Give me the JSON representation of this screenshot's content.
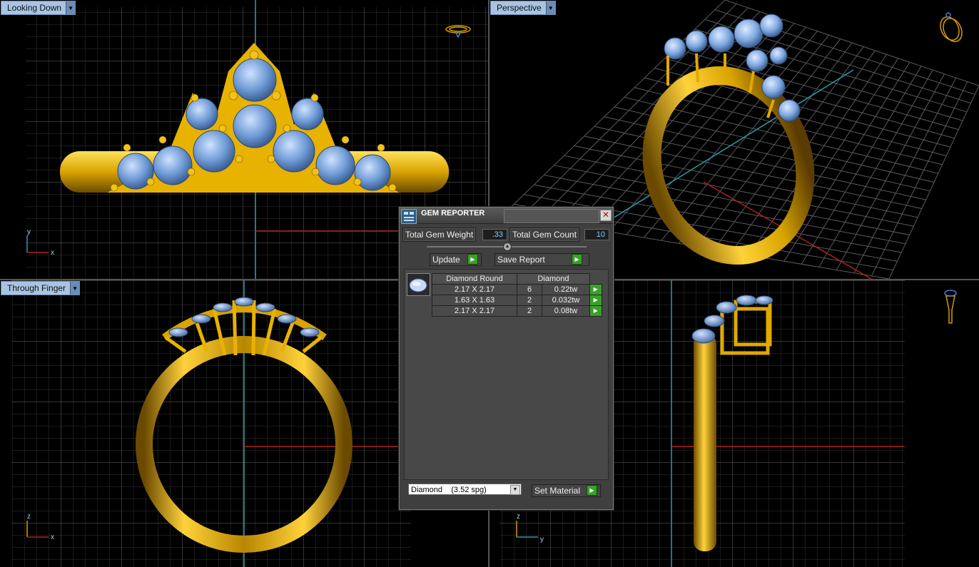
{
  "viewports": {
    "top_left": {
      "label": "Looking Down",
      "axis_a": "y",
      "axis_b": "x"
    },
    "top_right": {
      "label": "Perspective"
    },
    "bottom_left": {
      "label": "Through Finger",
      "axis_a": "z",
      "axis_b": "x"
    },
    "bottom_right": {
      "axis_a": "z",
      "axis_b": "y"
    }
  },
  "gem_reporter": {
    "title": "GEM REPORTER",
    "total_gem_weight_label": "Total Gem Weight",
    "total_gem_weight_value": ".33",
    "total_gem_count_label": "Total Gem Count",
    "total_gem_count_value": "10",
    "update_label": "Update",
    "save_report_label": "Save Report",
    "table": {
      "headers": [
        "Diamond Round",
        "Diamond"
      ],
      "rows": [
        {
          "size": "2.17 X 2.17",
          "count": "6",
          "weight": "0.22tw"
        },
        {
          "size": "1.63 X 1.63",
          "count": "2",
          "weight": "0.032tw"
        },
        {
          "size": "2.17 X 2.17",
          "count": "2",
          "weight": "0.08tw"
        }
      ]
    },
    "material_select": "Diamond    (3.52 spg)",
    "set_material_label": "Set Material"
  },
  "colors": {
    "gold": "#d9a400",
    "gem": "#7fa9e0",
    "grid": "#3c3c3c",
    "axis_red": "#b22020",
    "axis_teal": "#2a9aa8",
    "label_bg": "#a9c4e2"
  },
  "icons": {
    "close": "close-icon",
    "go": "play-arrow-icon",
    "view_cube": "ring-orientation-icon"
  }
}
